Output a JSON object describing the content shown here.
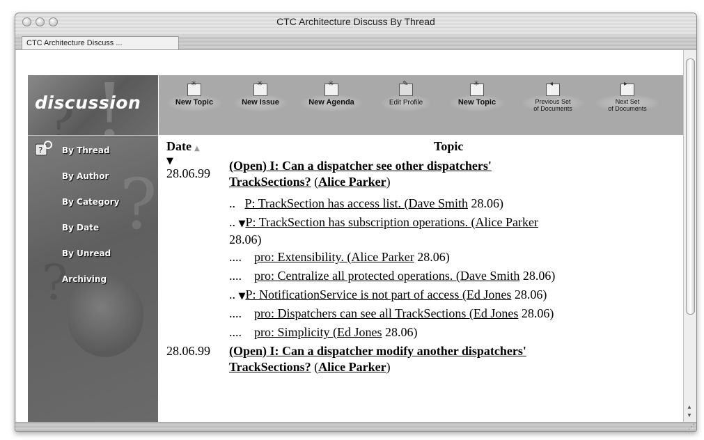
{
  "window": {
    "title": "CTC Architecture Discuss By Thread",
    "tab_label": "CTC Architecture Discuss ..."
  },
  "logo": {
    "text": "discussion"
  },
  "toolbar": {
    "buttons": [
      {
        "label": "New Topic",
        "icon": "new-document-icon"
      },
      {
        "label": "New Issue",
        "icon": "new-document-icon"
      },
      {
        "label": "New Agenda",
        "icon": "new-document-icon"
      },
      {
        "label": "Edit Profile",
        "icon": "edit-profile-icon"
      },
      {
        "label": "New Topic",
        "icon": "new-document-icon"
      },
      {
        "label_line1": "Previous Set",
        "label_line2": "of Documents",
        "icon": "previous-set-icon"
      },
      {
        "label_line1": "Next Set",
        "label_line2": "of Documents",
        "icon": "next-set-icon"
      }
    ]
  },
  "sidebar": {
    "items": [
      {
        "label": "By Thread",
        "icon": "question-key-icon"
      },
      {
        "label": "By Author"
      },
      {
        "label": "By Category"
      },
      {
        "label": "By Date"
      },
      {
        "label": "By Unread"
      },
      {
        "label": "Archiving"
      }
    ]
  },
  "table": {
    "col_date": "Date",
    "col_topic": "Topic",
    "rows": [
      {
        "date": "28.06.99",
        "expander": "▼",
        "title_line1": "(Open) I: Can a dispatcher see other dispatchers'",
        "title_line2": "TrackSections?",
        "author": "Alice Parker"
      },
      {
        "prefix": "..",
        "text": "P: TrackSection has access list. (Dave Smith",
        "date_suffix": "28.06)"
      },
      {
        "prefix": "..",
        "expander": "▼",
        "text_line1": "P: TrackSection has subscription operations. (Alice Parker",
        "date_suffix": "28.06)"
      },
      {
        "prefix": "....",
        "text": "pro: Extensibility. (Alice Parker",
        "date_suffix": "28.06)"
      },
      {
        "prefix": "....",
        "text": "pro: Centralize all protected operations. (Dave Smith",
        "date_suffix": "28.06)"
      },
      {
        "prefix": "..",
        "expander": "▼",
        "text": "P: NotificationService is not part of access (Ed Jones",
        "date_suffix": "28.06)"
      },
      {
        "prefix": "....",
        "text": "pro: Dispatchers can see all TrackSections (Ed Jones",
        "date_suffix": "28.06)"
      },
      {
        "prefix": "....",
        "text": "pro: Simplicity (Ed Jones",
        "date_suffix": "28.06)"
      },
      {
        "date": "28.06.99",
        "title_line1": "(Open) I: Can a dispatcher modify another dispatchers'",
        "title_line2": "TrackSections?",
        "author": "Alice Parker"
      }
    ]
  }
}
